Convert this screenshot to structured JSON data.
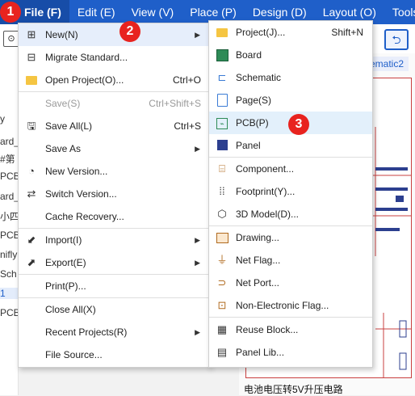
{
  "menubar": {
    "items": [
      "File (F)",
      "Edit (E)",
      "View (V)",
      "Place (P)",
      "Design (D)",
      "Layout (O)",
      "Tools"
    ]
  },
  "badges": [
    "1",
    "2",
    "3"
  ],
  "left_panel": {
    "fragments": [
      "y",
      "ard_",
      "#第",
      "PCB",
      "ard_",
      "小四",
      "PCB",
      "nifly",
      "Sch",
      "1",
      "PCB"
    ]
  },
  "canvas": {
    "tab_label": "ematic2",
    "schematic_label": "电池电压转5V升压电路"
  },
  "file_menu": {
    "items": [
      {
        "icon": "new-icon",
        "label": "New(N)",
        "shortcut": "",
        "submenu": true,
        "disabled": false
      },
      {
        "icon": "migrate-icon",
        "label": "Migrate Standard...",
        "shortcut": "",
        "submenu": false,
        "disabled": false
      },
      {
        "icon": "folder-icon",
        "label": "Open Project(O)...",
        "shortcut": "Ctrl+O",
        "submenu": false,
        "disabled": false
      },
      {
        "icon": "",
        "label": "Save(S)",
        "shortcut": "Ctrl+Shift+S",
        "submenu": false,
        "disabled": true
      },
      {
        "icon": "save-all-icon",
        "label": "Save All(L)",
        "shortcut": "Ctrl+S",
        "submenu": false,
        "disabled": false
      },
      {
        "icon": "",
        "label": "Save As",
        "shortcut": "",
        "submenu": true,
        "disabled": false
      },
      {
        "icon": "new-version-icon",
        "label": "New Version...",
        "shortcut": "",
        "submenu": false,
        "disabled": false
      },
      {
        "icon": "switch-version-icon",
        "label": "Switch Version...",
        "shortcut": "",
        "submenu": false,
        "disabled": false
      },
      {
        "icon": "",
        "label": "Cache Recovery...",
        "shortcut": "",
        "submenu": false,
        "disabled": false
      },
      {
        "icon": "import-icon",
        "label": "Import(I)",
        "shortcut": "",
        "submenu": true,
        "disabled": false
      },
      {
        "icon": "export-icon",
        "label": "Export(E)",
        "shortcut": "",
        "submenu": true,
        "disabled": false
      },
      {
        "icon": "",
        "label": "Print(P)...",
        "shortcut": "",
        "submenu": false,
        "disabled": false
      },
      {
        "icon": "",
        "label": "Close All(X)",
        "shortcut": "",
        "submenu": false,
        "disabled": false
      },
      {
        "icon": "",
        "label": "Recent Projects(R)",
        "shortcut": "",
        "submenu": true,
        "disabled": false
      },
      {
        "icon": "",
        "label": "File Source...",
        "shortcut": "",
        "submenu": false,
        "disabled": false
      }
    ]
  },
  "new_submenu": {
    "items": [
      {
        "icon": "folder-icon",
        "label": "Project(J)...",
        "shortcut": "Shift+N"
      },
      {
        "icon": "board-icon",
        "label": "Board",
        "shortcut": ""
      },
      {
        "icon": "schematic-icon",
        "label": "Schematic",
        "shortcut": ""
      },
      {
        "icon": "page-icon",
        "label": "Page(S)",
        "shortcut": ""
      },
      {
        "icon": "pcb-icon",
        "label": "PCB(P)",
        "shortcut": ""
      },
      {
        "icon": "panel-icon",
        "label": "Panel",
        "shortcut": ""
      },
      {
        "icon": "component-icon",
        "label": "Component...",
        "shortcut": ""
      },
      {
        "icon": "footprint-icon",
        "label": "Footprint(Y)...",
        "shortcut": ""
      },
      {
        "icon": "3d-model-icon",
        "label": "3D Model(D)...",
        "shortcut": ""
      },
      {
        "icon": "drawing-icon",
        "label": "Drawing...",
        "shortcut": ""
      },
      {
        "icon": "net-flag-icon",
        "label": "Net Flag...",
        "shortcut": ""
      },
      {
        "icon": "net-port-icon",
        "label": "Net Port...",
        "shortcut": ""
      },
      {
        "icon": "non-electronic-flag-icon",
        "label": "Non-Electronic Flag...",
        "shortcut": ""
      },
      {
        "icon": "reuse-block-icon",
        "label": "Reuse Block...",
        "shortcut": ""
      },
      {
        "icon": "panel-lib-icon",
        "label": "Panel Lib...",
        "shortcut": ""
      }
    ]
  },
  "colors": {
    "menubar": "#1f5fc9",
    "badge": "#e8231f",
    "highlight": "#e6eefb"
  }
}
